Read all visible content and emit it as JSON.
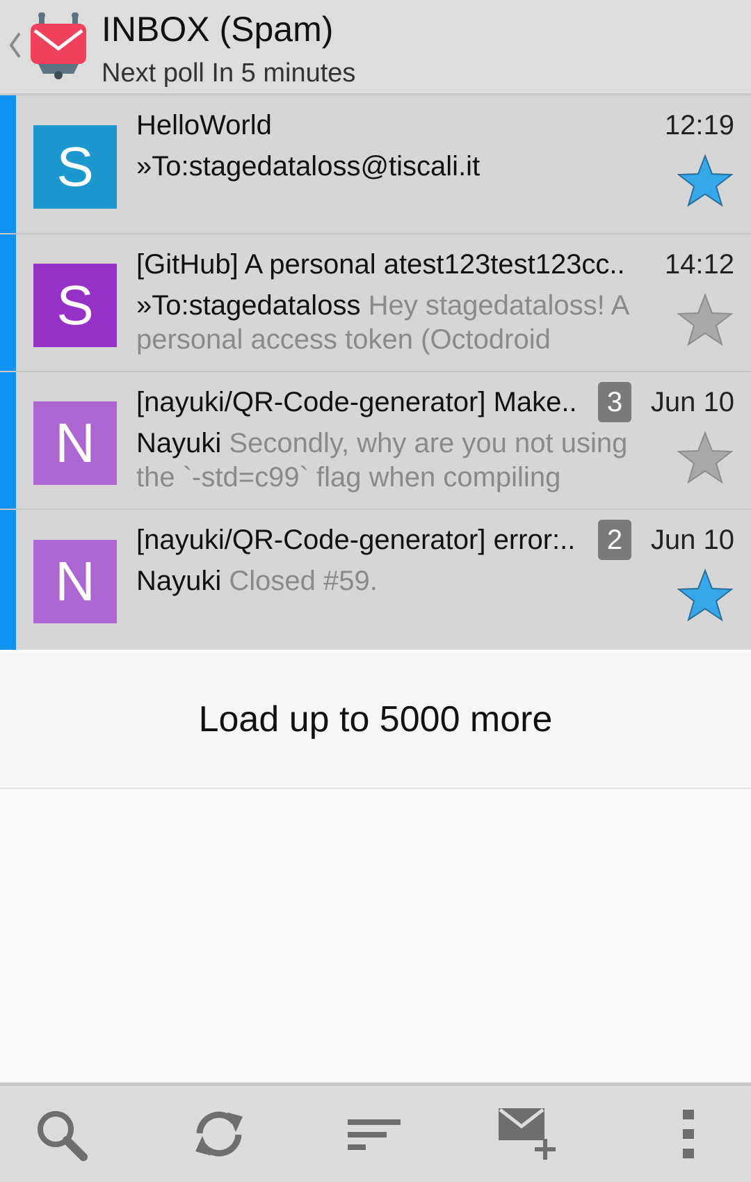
{
  "header": {
    "title": "INBOX (Spam)",
    "subtitle": "Next poll In 5 minutes"
  },
  "colors": {
    "unread_bar": "#0e93f5",
    "star_on": "#36a7e8",
    "star_off": "#a8a8a8"
  },
  "messages": [
    {
      "avatar_letter": "S",
      "avatar_color": "#1d98cf",
      "subject": "HelloWorld",
      "time": "12:19",
      "from": "»To:stagedataloss@tiscali.it",
      "preview": "",
      "count": "",
      "starred": true
    },
    {
      "avatar_letter": "S",
      "avatar_color": "#9631c8",
      "subject": "[GitHub] A personal atest123test123cc..",
      "time": "14:12",
      "from": "»To:stagedataloss",
      "preview": "Hey stagedataloss! A personal access token (Octodroid",
      "count": "",
      "starred": false
    },
    {
      "avatar_letter": "N",
      "avatar_color": "#ac66d1",
      "subject": "[nayuki/QR-Code-generator] Make..",
      "time": "Jun 10",
      "from": "Nayuki",
      "preview": "Secondly, why are you not using the `-std=c99` flag when compiling",
      "count": "3",
      "starred": false
    },
    {
      "avatar_letter": "N",
      "avatar_color": "#ac66d1",
      "subject": "[nayuki/QR-Code-generator] error:..",
      "time": "Jun 10",
      "from": "Nayuki",
      "preview": "Closed #59.",
      "count": "2",
      "starred": true
    }
  ],
  "load_more": "Load up to 5000 more",
  "toolbar": {
    "icons": [
      "search-icon",
      "refresh-icon",
      "sort-icon",
      "compose-icon",
      "overflow-menu-icon"
    ]
  }
}
